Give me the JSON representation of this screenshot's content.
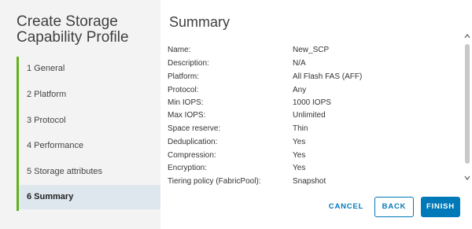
{
  "wizard": {
    "title": "Create Storage Capability Profile",
    "steps": [
      {
        "label": "1 General"
      },
      {
        "label": "2 Platform"
      },
      {
        "label": "3 Protocol"
      },
      {
        "label": "4 Performance"
      },
      {
        "label": "5 Storage attributes"
      },
      {
        "label": "6 Summary",
        "active": true
      }
    ],
    "accent_color": "#62b11c"
  },
  "summary": {
    "title": "Summary",
    "rows": [
      {
        "label": "Name:",
        "value": "New_SCP"
      },
      {
        "label": "Description:",
        "value": "N/A"
      },
      {
        "label": "Platform:",
        "value": "All Flash FAS (AFF)"
      },
      {
        "label": "Protocol:",
        "value": "Any"
      },
      {
        "label": "Min IOPS:",
        "value": "1000 IOPS"
      },
      {
        "label": "Max IOPS:",
        "value": "Unlimited"
      },
      {
        "label": "Space reserve:",
        "value": "Thin"
      },
      {
        "label": "Deduplication:",
        "value": "Yes"
      },
      {
        "label": "Compression:",
        "value": "Yes"
      },
      {
        "label": "Encryption:",
        "value": "Yes"
      },
      {
        "label": "Tiering policy (FabricPool):",
        "value": "Snapshot"
      }
    ]
  },
  "scrollbar": {
    "up_icon": "chevron-up-icon",
    "down_icon": "chevron-down-icon"
  },
  "buttons": {
    "cancel": "CANCEL",
    "back": "BACK",
    "finish": "FINISH",
    "primary_color": "#0079b8"
  }
}
